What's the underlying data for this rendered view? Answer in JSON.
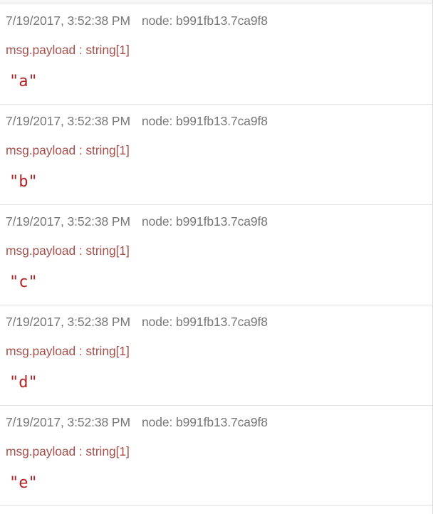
{
  "messages": [
    {
      "timestamp": "7/19/2017, 3:52:38 PM",
      "node": "node: b991fb13.7ca9f8",
      "topic": "msg.payload : string[1]",
      "payload": "\"a\""
    },
    {
      "timestamp": "7/19/2017, 3:52:38 PM",
      "node": "node: b991fb13.7ca9f8",
      "topic": "msg.payload : string[1]",
      "payload": "\"b\""
    },
    {
      "timestamp": "7/19/2017, 3:52:38 PM",
      "node": "node: b991fb13.7ca9f8",
      "topic": "msg.payload : string[1]",
      "payload": "\"c\""
    },
    {
      "timestamp": "7/19/2017, 3:52:38 PM",
      "node": "node: b991fb13.7ca9f8",
      "topic": "msg.payload : string[1]",
      "payload": "\"d\""
    },
    {
      "timestamp": "7/19/2017, 3:52:38 PM",
      "node": "node: b991fb13.7ca9f8",
      "topic": "msg.payload : string[1]",
      "payload": "\"e\""
    }
  ],
  "colors": {
    "meta_text": "#777777",
    "topic_text": "#a4514d",
    "payload_text": "#b22222",
    "divider": "#e3e3e3"
  }
}
